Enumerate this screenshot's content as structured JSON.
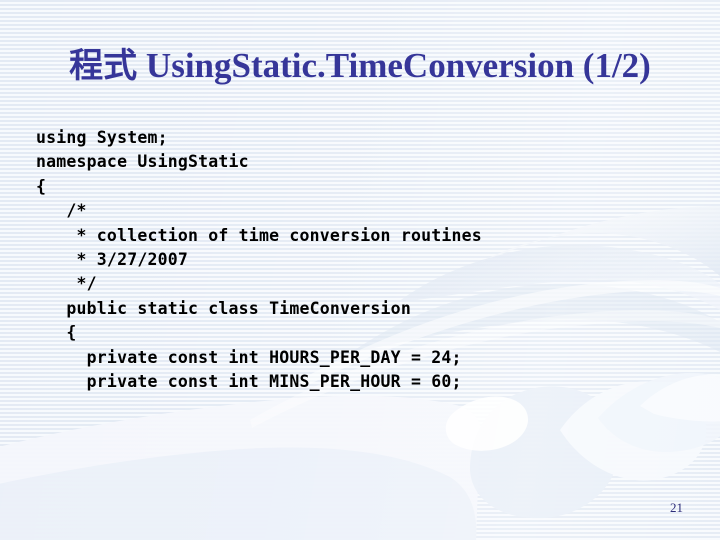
{
  "slide": {
    "title_cjk": "程式",
    "title_latin": " UsingStatic.TimeConversion (1/2)",
    "page_number": "21",
    "colors": {
      "title": "#363699",
      "code_text": "#000000",
      "background_stripe_dark": "#e3eaf4",
      "background_stripe_light": "#f7fafd",
      "page_number": "#2d2d7a"
    },
    "background_art": "handshake-watermark"
  },
  "code": {
    "language": "csharp",
    "lines": [
      "using System;",
      "namespace UsingStatic",
      "{",
      "   /*",
      "    * collection of time conversion routines",
      "    * 3/27/2007",
      "    */",
      "   public static class TimeConversion",
      "   {",
      "     private const int HOURS_PER_DAY = 24;",
      "     private const int MINS_PER_HOUR = 60;"
    ]
  }
}
